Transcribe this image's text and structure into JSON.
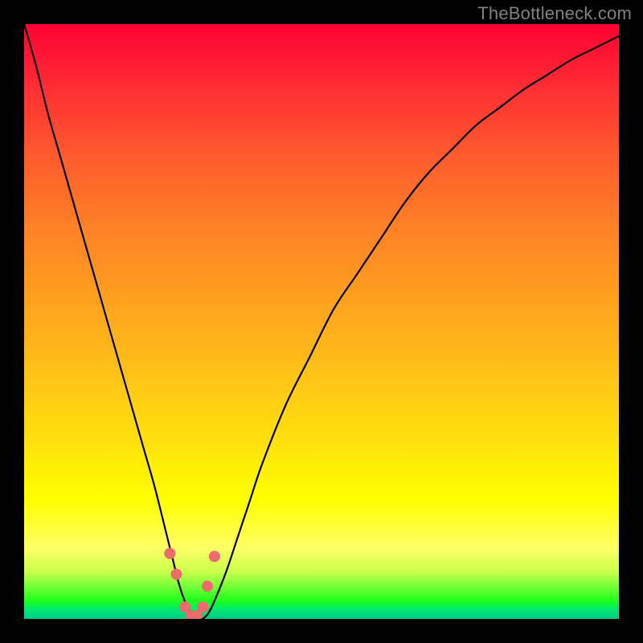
{
  "watermark": "TheBottleneck.com",
  "colors": {
    "frame": "#000000",
    "curve": "#000000",
    "marker_fill": "#ef6b6b",
    "marker_stroke": "#ef6b6b",
    "gradient_top": "#ff0033",
    "gradient_mid": "#ffff00",
    "gradient_bottom": "#00cc88"
  },
  "chart_data": {
    "type": "line",
    "title": "",
    "xlabel": "",
    "ylabel": "",
    "xlim": [
      0,
      100
    ],
    "ylim": [
      0,
      100
    ],
    "grid": false,
    "x": [
      0,
      2,
      4,
      6,
      8,
      10,
      12,
      14,
      16,
      18,
      20,
      22,
      24,
      25,
      26,
      27,
      28,
      29,
      30,
      31,
      32,
      34,
      36,
      38,
      40,
      44,
      48,
      52,
      56,
      60,
      64,
      68,
      72,
      76,
      80,
      84,
      88,
      92,
      96,
      100
    ],
    "y": [
      100,
      93,
      85,
      78,
      71,
      64,
      57,
      50,
      43,
      36,
      29,
      22,
      14,
      10,
      6,
      3,
      1,
      0,
      0,
      1,
      3,
      8,
      14,
      20,
      26,
      36,
      44,
      52,
      58,
      64,
      70,
      75,
      79,
      83,
      86,
      89,
      91.5,
      94,
      96,
      98
    ],
    "markers": {
      "x": [
        24.5,
        25.6,
        27.0,
        28.0,
        29.0,
        30.0,
        30.8,
        32.0
      ],
      "y": [
        11.0,
        7.5,
        2.0,
        0.5,
        0.5,
        2.0,
        5.5,
        10.5
      ]
    },
    "marker_radius_px": 7
  }
}
